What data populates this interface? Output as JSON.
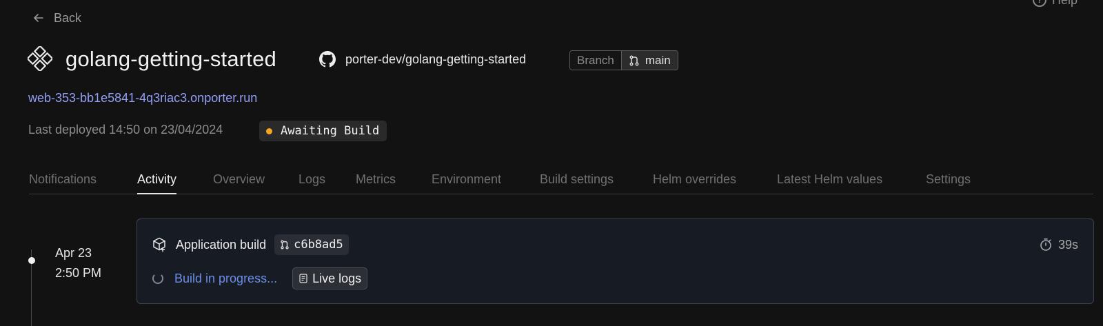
{
  "nav": {
    "back_label": "Back",
    "help_label": "Help"
  },
  "app": {
    "name": "golang-getting-started",
    "repo": "porter-dev/golang-getting-started",
    "branch_label": "Branch",
    "branch_value": "main",
    "url": "web-353-bb1e5841-4q3riac3.onporter.run",
    "last_deployed": "Last deployed 14:50 on 23/04/2024",
    "status": {
      "label": "Awaiting Build",
      "color": "#f5a623"
    }
  },
  "tabs": [
    {
      "label": "Notifications",
      "active": false
    },
    {
      "label": "Activity",
      "active": true
    },
    {
      "label": "Overview",
      "active": false
    },
    {
      "label": "Logs",
      "active": false
    },
    {
      "label": "Metrics",
      "active": false
    },
    {
      "label": "Environment",
      "active": false
    },
    {
      "label": "Build settings",
      "active": false
    },
    {
      "label": "Helm overrides",
      "active": false
    },
    {
      "label": "Latest Helm values",
      "active": false
    },
    {
      "label": "Settings",
      "active": false
    }
  ],
  "activity": [
    {
      "date": "Apr 23",
      "time": "2:50 PM",
      "title": "Application build",
      "commit": "c6b8ad5",
      "duration": "39s",
      "status_text": "Build in progress...",
      "live_logs_label": "Live logs"
    }
  ],
  "colors": {
    "accent_link": "#949ff5",
    "progress": "#6c8ee8",
    "background": "#121212"
  }
}
